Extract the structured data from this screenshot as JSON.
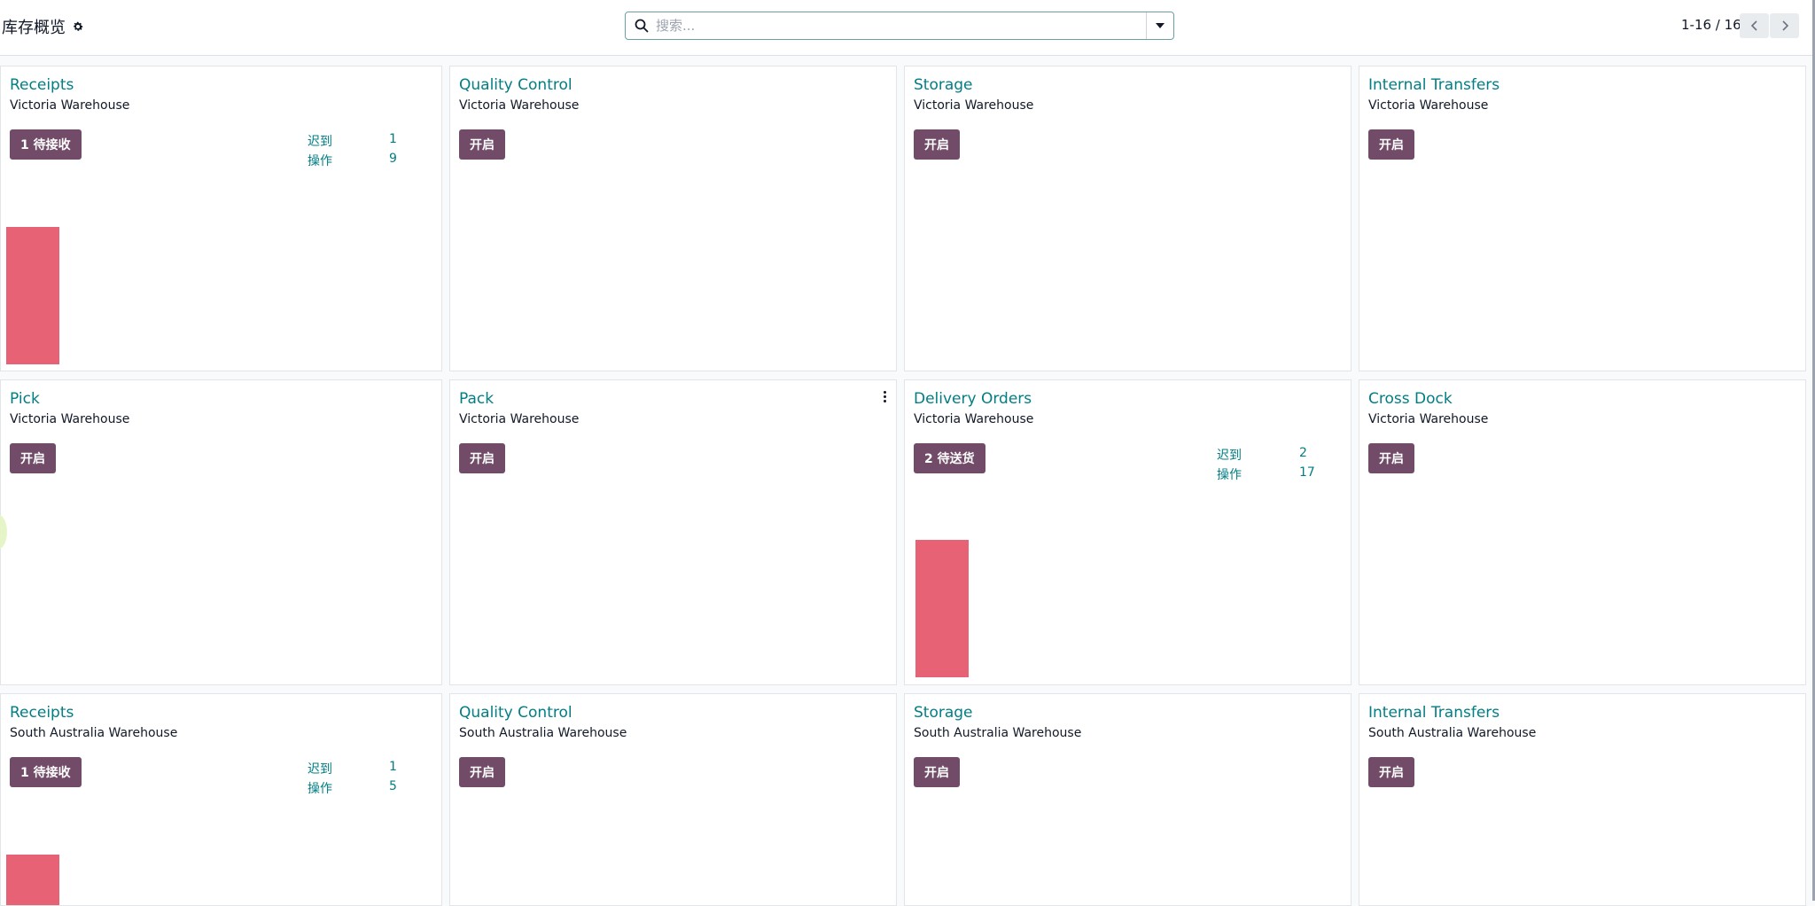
{
  "header": {
    "title": "库存概览",
    "search_placeholder": "搜索...",
    "pager": "1-16 / 16"
  },
  "cards": [
    {
      "title": "Receipts",
      "warehouse": "Victoria Warehouse",
      "button": "1 待接收",
      "late_label": "迟到",
      "late": "1",
      "ops_label": "操作",
      "ops": "9"
    },
    {
      "title": "Quality Control",
      "warehouse": "Victoria Warehouse",
      "button": "开启"
    },
    {
      "title": "Storage",
      "warehouse": "Victoria Warehouse",
      "button": "开启"
    },
    {
      "title": "Internal Transfers",
      "warehouse": "Victoria Warehouse",
      "button": "开启"
    },
    {
      "title": "Pick",
      "warehouse": "Victoria Warehouse",
      "button": "开启"
    },
    {
      "title": "Pack",
      "warehouse": "Victoria Warehouse",
      "button": "开启"
    },
    {
      "title": "Delivery Orders",
      "warehouse": "Victoria Warehouse",
      "button": "2 待送货",
      "late_label": "迟到",
      "late": "2",
      "ops_label": "操作",
      "ops": "17"
    },
    {
      "title": "Cross Dock",
      "warehouse": "Victoria Warehouse",
      "button": "开启"
    },
    {
      "title": "Receipts",
      "warehouse": "South Australia Warehouse",
      "button": "1 待接收",
      "late_label": "迟到",
      "late": "1",
      "ops_label": "操作",
      "ops": "5"
    },
    {
      "title": "Quality Control",
      "warehouse": "South Australia Warehouse",
      "button": "开启"
    },
    {
      "title": "Storage",
      "warehouse": "South Australia Warehouse",
      "button": "开启"
    },
    {
      "title": "Internal Transfers",
      "warehouse": "South Australia Warehouse",
      "button": "开启"
    }
  ],
  "colors": {
    "title": "#017e84",
    "button": "#714b67",
    "bar": "#e86276"
  }
}
